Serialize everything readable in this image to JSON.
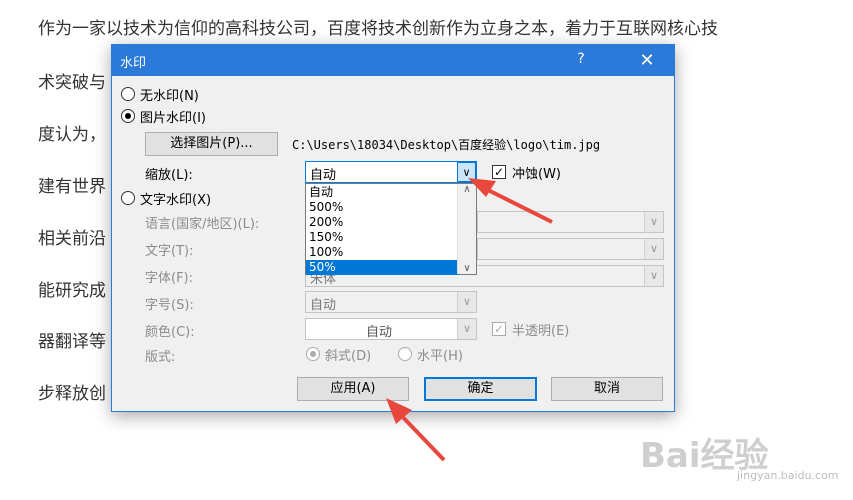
{
  "background_paragraph": [
    "作为一家以技术为信仰的高科技公司，百度将技术创新作为立身之本，着力于互联网核心技",
    "术突破与                                                                                              水平。百",
    "度认为，                                                                                                 。百度",
    "建有世界                                                                                              工智能等",
    "相关前沿                                                                                              度人工智",
    "能研究成                                                                                              图像、机",
    "器翻译等                                                                                              益，进一",
    "步释放创"
  ],
  "dialog": {
    "title": "水印",
    "help_label": "?",
    "close_label": "✕",
    "no_watermark_label": "无水印(N)",
    "picture_watermark_label": "图片水印(I)",
    "select_picture_button": "选择图片(P)...",
    "picture_path": "C:\\Users\\18034\\Desktop\\百度经验\\logo\\tim.jpg",
    "scale_label": "缩放(L):",
    "scale_value": "自动",
    "washout_label": "冲蚀(W)",
    "scale_options": [
      "自动",
      "500%",
      "200%",
      "150%",
      "100%",
      "50%"
    ],
    "scale_highlighted": "50%",
    "text_watermark_label": "文字水印(X)",
    "language_label": "语言(国家/地区)(L):",
    "text_label": "文字(T):",
    "font_label": "字体(F):",
    "font_value": "宋体",
    "size_label": "字号(S):",
    "size_value": "自动",
    "color_label": "颜色(C):",
    "color_value": "自动",
    "semi_transparent_label": "半透明(E)",
    "layout_label": "版式:",
    "diagonal_label": "斜式(D)",
    "horizontal_label": "水平(H)",
    "apply_button": "应用(A)",
    "ok_button": "确定",
    "cancel_button": "取消"
  },
  "watermark": {
    "logo_text": "Bai经验",
    "url_text": "jingyan.baidu.com"
  },
  "colors": {
    "title_bar": "#2b79d8",
    "selection": "#0078d7",
    "annotation_arrow": "#e8473d"
  }
}
